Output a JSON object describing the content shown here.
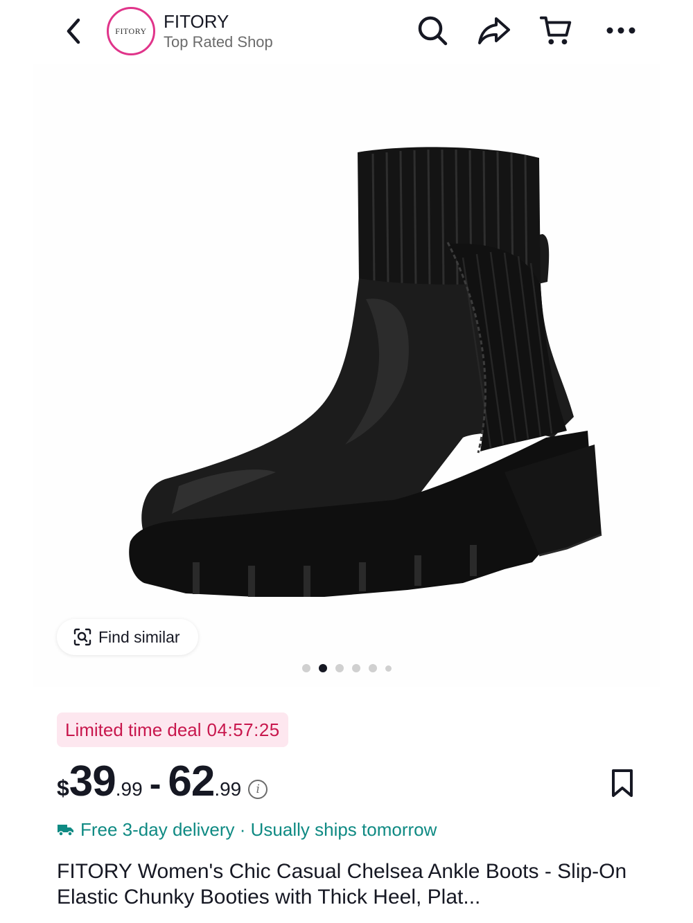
{
  "header": {
    "shop_logo_text": "FITORY",
    "shop_name": "FITORY",
    "shop_subtitle": "Top Rated Shop",
    "icons": [
      "chevron-left-icon",
      "search-icon",
      "share-icon",
      "cart-icon",
      "more-icon"
    ]
  },
  "gallery": {
    "find_similar_label": "Find similar",
    "carousel": {
      "total_dots": 6,
      "active_index": 1
    }
  },
  "deal": {
    "label": "Limited time deal",
    "timer": "04:57:25"
  },
  "price": {
    "currency": "$",
    "low_dollars": "39",
    "low_cents": ".99",
    "separator": "-",
    "high_dollars": "62",
    "high_cents": ".99"
  },
  "delivery": {
    "text": "Free 3-day delivery · Usually ships tomorrow"
  },
  "product": {
    "title": "FITORY Women's Chic Casual Chelsea Ankle Boots - Slip-On Elastic Chunky Booties with Thick Heel, Plat..."
  },
  "colors": {
    "brand_pink": "#e0348a",
    "deal_text": "#c8174d",
    "deal_bg": "#fde7ef",
    "delivery_teal": "#0f8a83",
    "text_primary": "#161823"
  }
}
